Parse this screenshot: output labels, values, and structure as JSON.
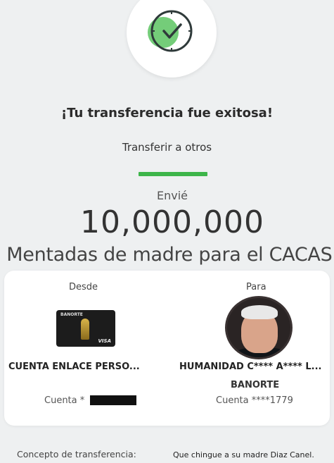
{
  "success": {
    "icon": "check-circle-icon",
    "title": "¡Tu transferencia fue exitosa!",
    "subtitle": "Transferir a otros",
    "accent_color": "#3db54a"
  },
  "amount": {
    "label": "Envié",
    "value": "10,000,000"
  },
  "caption": "Mentadas de madre para el CACAS.",
  "from": {
    "label": "Desde",
    "card_brand": "BANORTE",
    "card_network": "VISA",
    "account_name": "CUENTA ENLACE PERSO...",
    "account_prefix": "Cuenta *"
  },
  "to": {
    "label": "Para",
    "account_name": "HUMANIDAD C**** A**** L...",
    "bank": "BANORTE",
    "account": "Cuenta ****1779"
  },
  "concept": {
    "label": "Concepto de transferencia:",
    "value": "Que chingue a su madre Diaz Canel."
  }
}
